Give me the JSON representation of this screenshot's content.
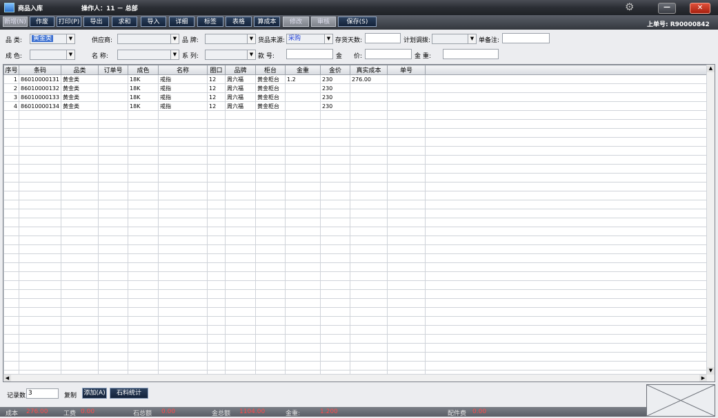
{
  "window": {
    "title": "商品入库",
    "operator": "操作人：11 － 总部",
    "bill_no": "上单号: R90000842"
  },
  "toolbar": [
    {
      "label": "新增(N)",
      "disabled": true
    },
    {
      "label": "作废",
      "disabled": false
    },
    {
      "label": "打印(P)",
      "disabled": false
    },
    {
      "label": "导出",
      "disabled": false
    },
    {
      "label": "求和",
      "disabled": false
    },
    {
      "label": "导入",
      "disabled": false
    },
    {
      "label": "详细",
      "disabled": false
    },
    {
      "label": "标签",
      "disabled": false
    },
    {
      "label": "表格",
      "disabled": false
    },
    {
      "label": "算成本",
      "disabled": false
    },
    {
      "label": "修改",
      "disabled": true
    },
    {
      "label": "审核",
      "disabled": true
    },
    {
      "label": "保存(S)",
      "disabled": false
    }
  ],
  "form": {
    "category_label": "品 类:",
    "category_value": "黄金类",
    "supplier_label": "供应商:",
    "supplier_value": "",
    "brand_label": "品 牌:",
    "brand_value": "",
    "source_label": "货品来源:",
    "source_value": "采购",
    "stock_days_label": "存货天数:",
    "stock_days_value": "",
    "plan_label": "计划调拨:",
    "plan_value": "",
    "remark_label": "单备注:",
    "remark_value": "",
    "color_label": "成 色:",
    "color_value": "",
    "name_label": "名 称:",
    "name_value": "",
    "series_label": "系 列:",
    "series_value": "",
    "style_label": "款 号:",
    "style_value": "",
    "gold_label": "金",
    "price_label": "价:",
    "price_value": "",
    "weight_label": "金 重:",
    "weight_value": ""
  },
  "table": {
    "columns": [
      "序号",
      "条码",
      "品类",
      "订单号",
      "成色",
      "名称",
      "圈口",
      "品牌",
      "柜台",
      "金重",
      "金价",
      "真实成本",
      "单号"
    ],
    "rows": [
      [
        "1",
        "86010000131",
        "黄金类",
        "",
        "18K",
        "戒指",
        "12",
        "周六福",
        "黄金柜台",
        "1.2",
        "230",
        "276.00",
        ""
      ],
      [
        "2",
        "86010000132",
        "黄金类",
        "",
        "18K",
        "戒指",
        "12",
        "周六福",
        "黄金柜台",
        "",
        "230",
        "",
        ""
      ],
      [
        "3",
        "86010000133",
        "黄金类",
        "",
        "18K",
        "戒指",
        "12",
        "周六福",
        "黄金柜台",
        "",
        "230",
        "",
        ""
      ],
      [
        "4",
        "86010000134",
        "黄金类",
        "",
        "18K",
        "戒指",
        "12",
        "周六福",
        "黄金柜台",
        "",
        "230",
        "",
        ""
      ]
    ]
  },
  "bottom": {
    "record_count_label": "记录数",
    "record_count_value": "3",
    "copy_label": "复制",
    "add_label": "添加(A)",
    "stone_stats_label": "石料统计"
  },
  "status": {
    "cost_label": "成本",
    "cost_value": "276.00",
    "labor_label": "工费",
    "labor_value": "0.00",
    "stone_label": "石总额",
    "stone_value": "0.00",
    "gold_total_label": "金总额",
    "gold_total_value": "1104.00",
    "gold_weight_label": "金重:",
    "gold_weight_value": "1.200",
    "accessory_label": "配件费",
    "accessory_value": "0.00"
  }
}
